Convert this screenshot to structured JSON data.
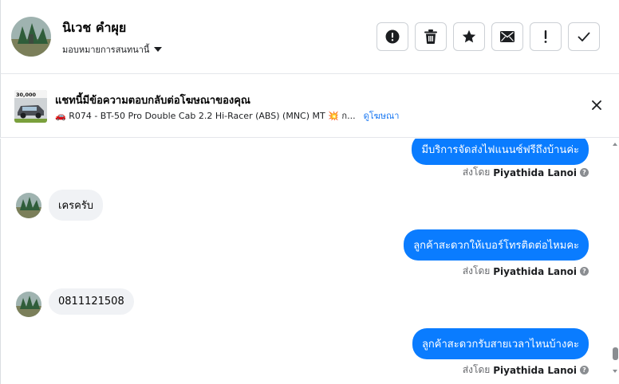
{
  "header": {
    "contact_name": "นิเวช คำผุย",
    "assign_label": "มอบหมายการสนทนานี้",
    "actions": [
      {
        "name": "spam-button",
        "icon": "alert-circle-icon"
      },
      {
        "name": "delete-button",
        "icon": "trash-icon"
      },
      {
        "name": "star-button",
        "icon": "star-icon"
      },
      {
        "name": "mark-unread-button",
        "icon": "envelope-icon"
      },
      {
        "name": "follow-up-button",
        "icon": "exclamation-icon"
      },
      {
        "name": "mark-done-button",
        "icon": "checkmark-icon"
      }
    ]
  },
  "ad": {
    "thumb_price": "30,000",
    "title": "แชทนี้มีข้อความตอบกลับต่อโฆษณาของคุณ",
    "subtitle": "🚗 R074 - BT-50 Pro Double Cab 2.2 Hi-Racer (ABS) (MNC) MT 💥 ก...",
    "link": "ดูโฆษณา"
  },
  "messages": [
    {
      "dir": "out",
      "text": "มีบริการจัดส่งไฟแนนซ์ฟรีถึงบ้านค่ะ",
      "sent_by_prefix": "ส่งโดย",
      "sent_by": "Piyathida Lanoi"
    },
    {
      "dir": "in",
      "text": "เครครับ"
    },
    {
      "dir": "out",
      "text": "ลูกค้าสะดวกให้เบอร์โทรติดต่อไหมคะ",
      "sent_by_prefix": "ส่งโดย",
      "sent_by": "Piyathida Lanoi"
    },
    {
      "dir": "in",
      "text": "0811121508"
    },
    {
      "dir": "out",
      "text": "ลูกค้าสะดวกรับสายเวลาไหนบ้างคะ",
      "sent_by_prefix": "ส่งโดย",
      "sent_by": "Piyathida Lanoi"
    }
  ],
  "colors": {
    "outgoing_bubble": "#0a7cff",
    "incoming_bubble": "#f0f2f5",
    "link": "#1877f2"
  }
}
